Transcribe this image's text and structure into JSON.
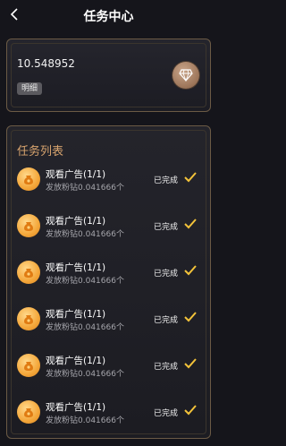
{
  "header": {
    "title": "任务中心",
    "back_icon": "chevron-left-icon"
  },
  "balance": {
    "value": "10.548952",
    "detail_label": "明细",
    "diamond_icon": "diamond-icon"
  },
  "tasks": {
    "title": "任务列表",
    "items": [
      {
        "name": "观看广告(1/1)",
        "desc": "发放粉钻0.041666个",
        "status": "已完成"
      },
      {
        "name": "观看广告(1/1)",
        "desc": "发放粉钻0.041666个",
        "status": "已完成"
      },
      {
        "name": "观看广告(1/1)",
        "desc": "发放粉钻0.041666个",
        "status": "已完成"
      },
      {
        "name": "观看广告(1/1)",
        "desc": "发放粉钻0.041666个",
        "status": "已完成"
      },
      {
        "name": "观看广告(1/1)",
        "desc": "发放粉钻0.041666个",
        "status": "已完成"
      },
      {
        "name": "观看广告(1/1)",
        "desc": "发放粉钻0.041666个",
        "status": "已完成"
      }
    ]
  },
  "colors": {
    "accent_gold": "#d8a46e",
    "check_yellow": "#f3c33a",
    "background": "#15151b"
  }
}
